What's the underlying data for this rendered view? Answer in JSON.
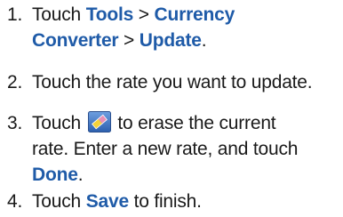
{
  "steps": [
    {
      "number": "1.",
      "segments": {
        "t1": "Touch",
        "k1": "Tools",
        "t2": ">",
        "k2": "Currency",
        "k3": "Converter",
        "t3": ">",
        "k4": "Update",
        "t4": "."
      }
    },
    {
      "number": "2.",
      "text": "Touch the rate you want to update."
    },
    {
      "number": "3.",
      "segments": {
        "t1": "Touch",
        "t2": "to erase the current",
        "t3": "rate. Enter a new rate, and touch",
        "k1": "Done",
        "t4": "."
      },
      "icon": "erase-icon"
    },
    {
      "number": "4.",
      "segments": {
        "t1": "Touch",
        "k1": "Save",
        "t2": "to finish."
      }
    }
  ],
  "colors": {
    "text": "#1a1a1a",
    "keyword": "#1f5ba8",
    "icon_background": "#3a74c4"
  }
}
